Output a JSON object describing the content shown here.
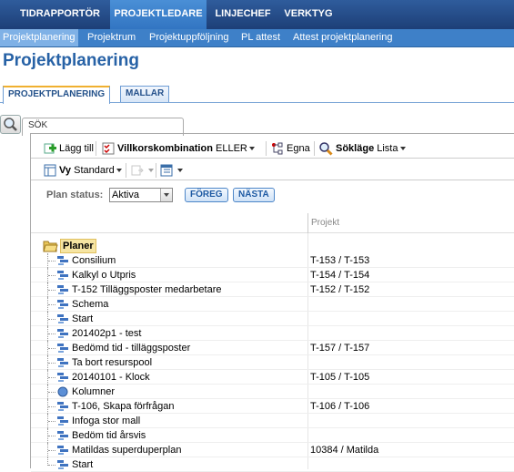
{
  "topnav": {
    "tabs": [
      {
        "label": "TIDRAPPORTÖR"
      },
      {
        "label": "PROJEKTLEDARE"
      },
      {
        "label": "LINJECHEF"
      },
      {
        "label": "VERKTYG"
      }
    ]
  },
  "subnav": {
    "items": [
      {
        "label": "Projektplanering"
      },
      {
        "label": "Projektrum"
      },
      {
        "label": "Projektuppföljning"
      },
      {
        "label": "PL attest"
      },
      {
        "label": "Attest projektplanering"
      }
    ]
  },
  "page_title": "Projektplanering",
  "section_tabs": [
    {
      "label": "PROJEKTPLANERING"
    },
    {
      "label": "MALLAR"
    }
  ],
  "search_tab": "SÖK",
  "toolbar": {
    "add_label": "Lägg till",
    "condition_label": "Villkorskombination",
    "condition_value": "ELLER",
    "own_label": "Egna",
    "search_mode_label": "Sökläge",
    "search_mode_value": "Lista",
    "view_label": "Vy",
    "view_value": "Standard"
  },
  "plan_status": {
    "label": "Plan status:",
    "value": "Aktiva",
    "prev_button": "FÖREG",
    "next_button": "NÄSTA"
  },
  "grid": {
    "column_project": "Projekt",
    "root_label": "Planer",
    "rows": [
      {
        "name": "Consilium",
        "project": "T-153 / T-153",
        "icon": "plan-icon"
      },
      {
        "name": "Kalkyl o Utpris",
        "project": "T-154 / T-154",
        "icon": "plan-icon"
      },
      {
        "name": "T-152 Tilläggsposter medarbetare",
        "project": "T-152 / T-152",
        "icon": "plan-icon"
      },
      {
        "name": "Schema",
        "project": "",
        "icon": "plan-icon"
      },
      {
        "name": "Start",
        "project": "",
        "icon": "plan-icon"
      },
      {
        "name": "201402p1 - test",
        "project": "",
        "icon": "plan-icon"
      },
      {
        "name": "Bedömd tid - tilläggsposter",
        "project": "T-157 / T-157",
        "icon": "plan-icon"
      },
      {
        "name": "Ta bort resurspool",
        "project": "",
        "icon": "plan-icon"
      },
      {
        "name": "20140101 - Klock",
        "project": "T-105 / T-105",
        "icon": "plan-icon"
      },
      {
        "name": "Kolumner",
        "project": "",
        "icon": "circle-icon"
      },
      {
        "name": "T-106, Skapa förfrågan",
        "project": "T-106 / T-106",
        "icon": "plan-icon"
      },
      {
        "name": "Infoga stor mall",
        "project": "",
        "icon": "plan-icon"
      },
      {
        "name": "Bedöm tid årsvis",
        "project": "",
        "icon": "plan-icon"
      },
      {
        "name": "Matildas superduperplan",
        "project": "10384 / Matilda",
        "icon": "plan-icon"
      },
      {
        "name": "Start",
        "project": "",
        "icon": "plan-icon"
      }
    ]
  },
  "colors": {
    "nav_dark": "#1d3f77",
    "nav_active": "#3275c2",
    "subnav": "#3e80c8",
    "title": "#2762a6"
  }
}
